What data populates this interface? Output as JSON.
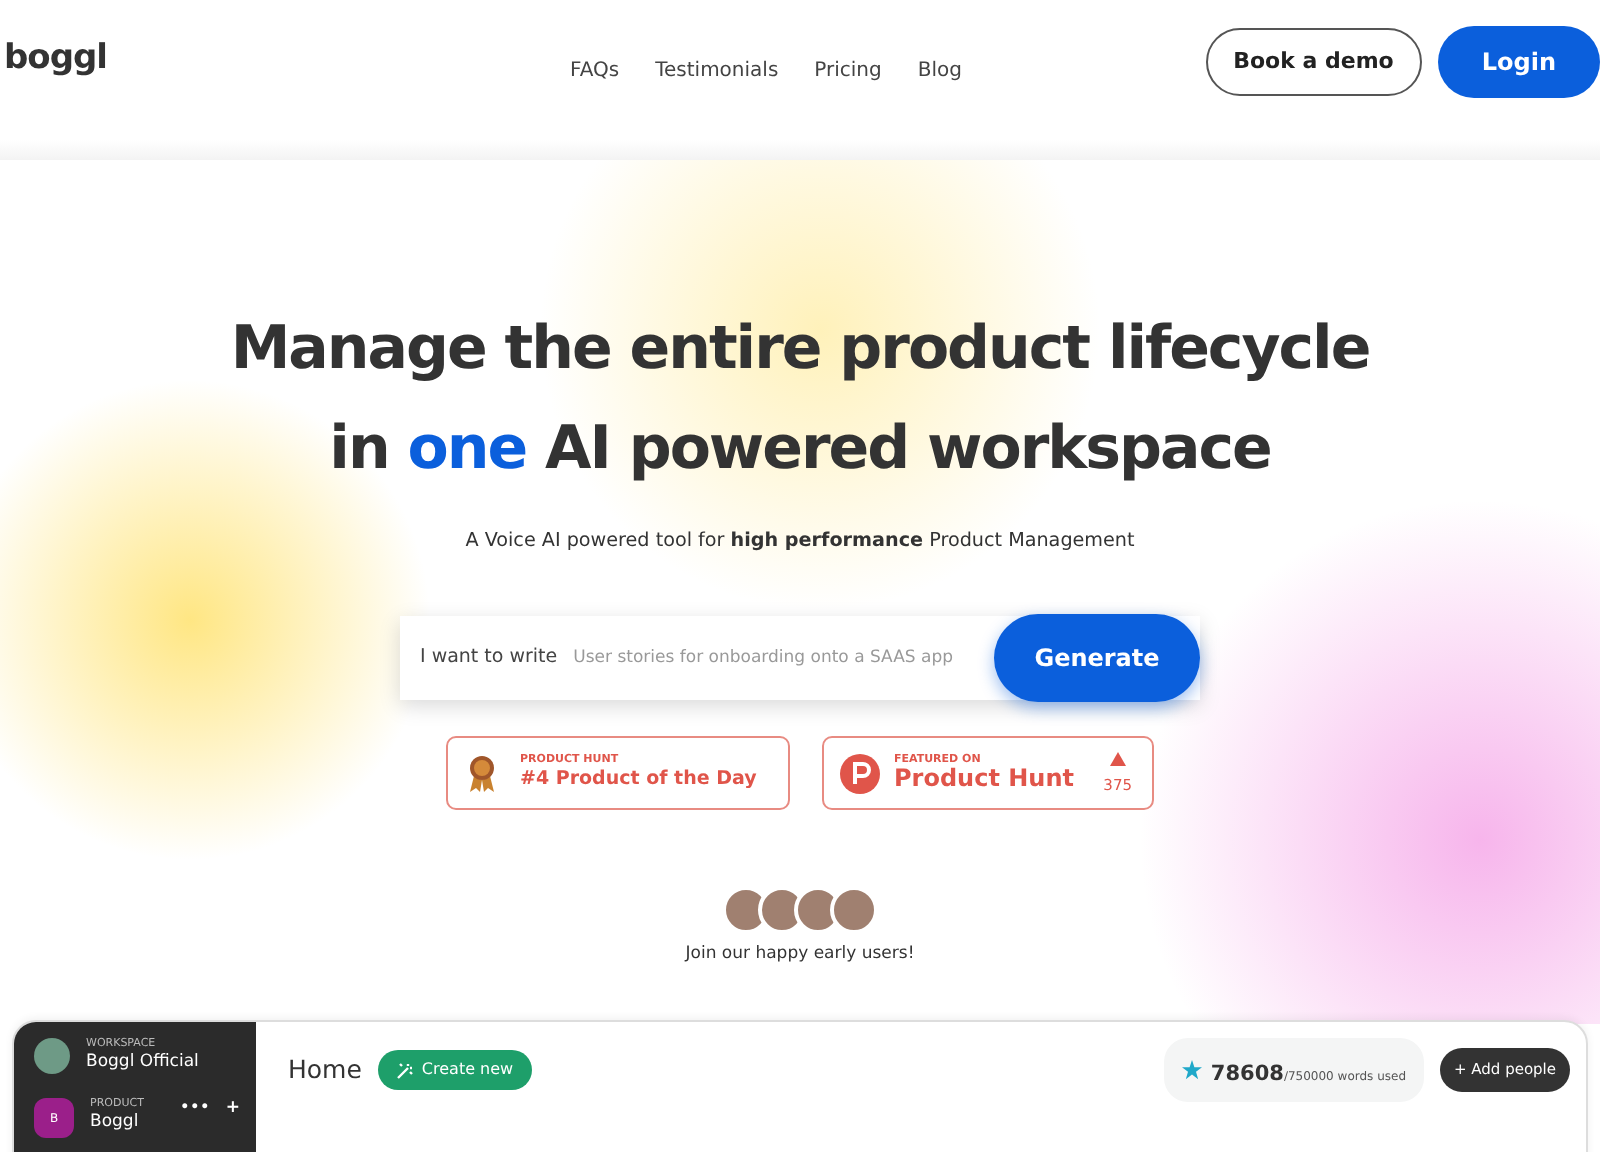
{
  "nav": {
    "logo": "boggl",
    "links": [
      "FAQs",
      "Testimonials",
      "Pricing",
      "Blog"
    ],
    "demo_button": "Book a demo",
    "login_button": "Login"
  },
  "hero": {
    "title_line_1": "Manage the entire product lifecycle",
    "title_line_2": {
      "before": "in",
      "accent": "one",
      "after": "AI powered workspace"
    },
    "subtitle": "A Voice AI powered tool for **high performance** Product Management",
    "prompt": {
      "label": "I want to write",
      "placeholder": "User stories for onboarding onto a SAAS app",
      "button": "Generate"
    },
    "badges": [
      {
        "kind": "award",
        "eyebrow": "PRODUCT HUNT",
        "title": "#4 Product of the Day"
      },
      {
        "kind": "featured",
        "eyebrow": "FEATURED ON",
        "title": "Product Hunt",
        "count": "375"
      }
    ],
    "avatars": [
      {
        "kind": "photo"
      },
      {
        "kind": "photo"
      },
      {
        "kind": "photo"
      },
      {
        "kind": "photo"
      }
    ],
    "users_caption": "Join our happy early users!"
  },
  "app": {
    "sidebar": {
      "workspace_label": "WORKSPACE",
      "workspace_name": "Boggl Official",
      "product_initial": "B",
      "product_label": "PRODUCT",
      "more": "•••",
      "add": "+",
      "product_name": "Boggl"
    },
    "header": {
      "title": "Home",
      "create_button": "Create new",
      "words_used": "78608",
      "words_limit": "/750000 words used",
      "add_people": "+ Add people"
    }
  }
}
